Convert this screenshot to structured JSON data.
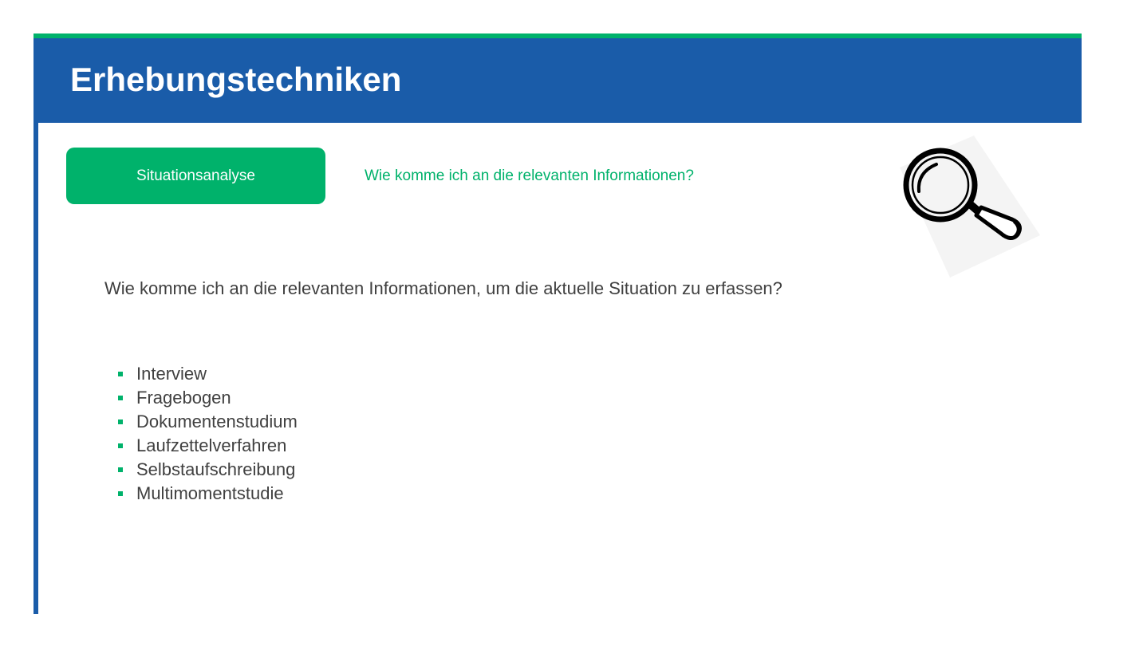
{
  "slide": {
    "title": "Erhebungstechniken",
    "tag_label": "Situationsanalyse",
    "tag_question": "Wie komme ich an die relevanten Informationen?",
    "intro_text": "Wie komme ich an die relevanten Informationen, um die aktuelle Situation zu erfassen?",
    "icon": "magnifying-glass-icon",
    "bullets": [
      "Interview",
      "Fragebogen",
      "Dokumentenstudium",
      "Laufzettelverfahren",
      "Selbstaufschreibung",
      "Multimomentstudie"
    ]
  },
  "colors": {
    "header_blue": "#1a5ca9",
    "accent_green": "#00b26b",
    "body_text": "#404040"
  }
}
